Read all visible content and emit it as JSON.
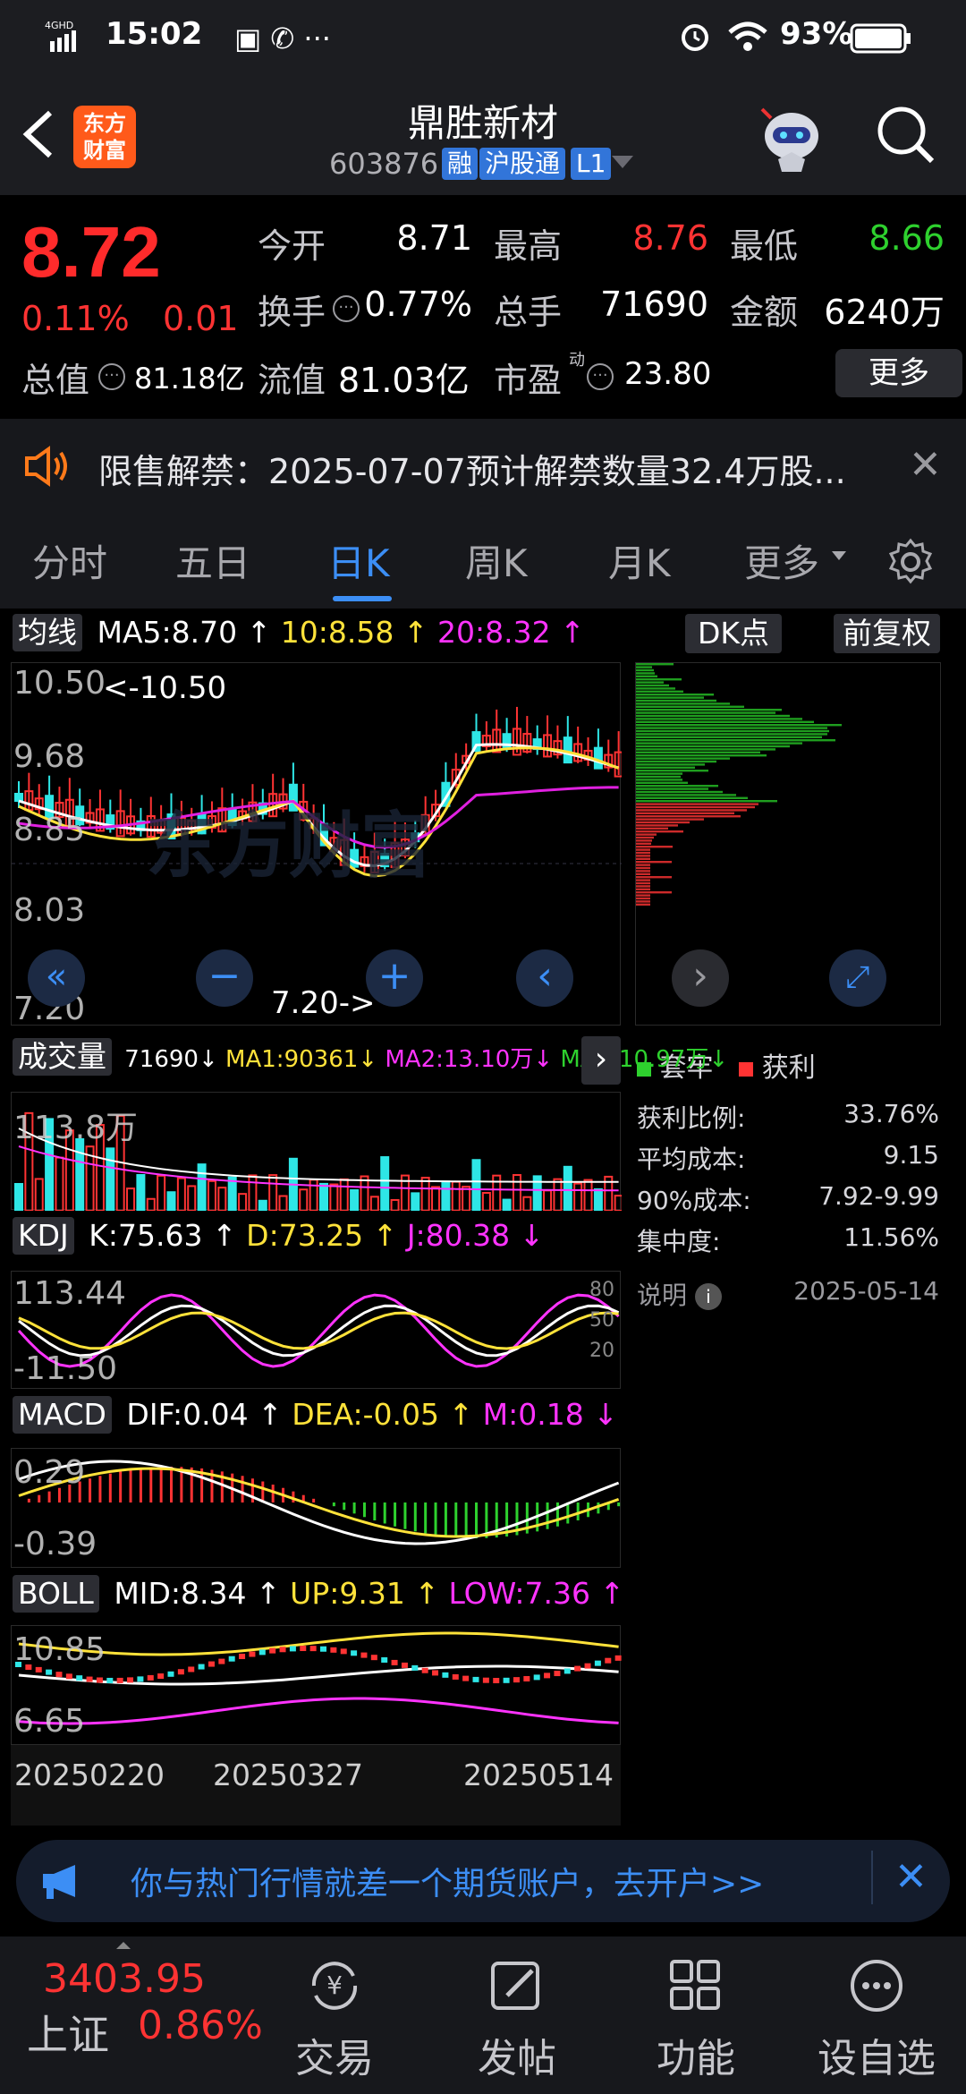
{
  "status": {
    "network": "4GHD",
    "time": "15:02",
    "icons_left": [
      "edit-doc-icon",
      "phone-icon",
      "more-dots"
    ],
    "battery": "93%"
  },
  "header": {
    "title": "鼎胜新材",
    "code": "603876",
    "tags": [
      "融",
      "沪股通",
      "L1"
    ],
    "logo_text": [
      "东方",
      "财富"
    ]
  },
  "quote": {
    "price": "8.72",
    "change_pct": "0.11%",
    "change": "0.01",
    "open_label": "今开",
    "open": "8.71",
    "high_label": "最高",
    "high": "8.76",
    "low_label": "最低",
    "low": "8.66",
    "turnover_label": "换手",
    "turnover": "0.77%",
    "volume_label": "总手",
    "volume": "71690",
    "amount_label": "金额",
    "amount": "6240万",
    "mcap_label": "总值",
    "mcap": "81.18亿",
    "float_label": "流值",
    "float": "81.03亿",
    "pe_label": "市盈",
    "pe_sup": "动",
    "pe": "23.80",
    "more": "更多"
  },
  "notice": {
    "text": "限售解禁：2025-07-07预计解禁数量32.4万股..."
  },
  "tabs": [
    "分时",
    "五日",
    "日K",
    "周K",
    "月K",
    "更多"
  ],
  "active_tab": "日K",
  "ma": {
    "selector": "均线",
    "ma5": "MA5:8.70",
    "ma10": "10:8.58",
    "ma20": "20:8.32",
    "dk": "DK点",
    "fq": "前复权"
  },
  "kline": {
    "y_labels": [
      "10.50",
      "9.68",
      "8.85",
      "8.03",
      "7.20"
    ],
    "max_label": "<-10.50",
    "min_label": "7.20->",
    "watermark": "东方财富"
  },
  "volume": {
    "selector": "成交量",
    "vol": "71690",
    "ma1": "MA1:90361",
    "ma2": "MA2:13.10万",
    "ma3": "MA3:10.97万",
    "y_label": "113.8万"
  },
  "kdj": {
    "selector": "KDJ",
    "k": "K:75.63",
    "d": "D:73.25",
    "j": "J:80.38",
    "y_top": "113.44",
    "y_bot": "-11.50",
    "levels": [
      "80",
      "50",
      "20"
    ]
  },
  "macd": {
    "selector": "MACD",
    "dif": "DIF:0.04",
    "dea": "DEA:-0.05",
    "m": "M:0.18",
    "y_top": "0.29",
    "y_bot": "-0.39"
  },
  "boll": {
    "selector": "BOLL",
    "mid": "MID:8.34",
    "up": "UP:9.31",
    "low": "LOW:7.36",
    "y_top": "10.85",
    "y_bot": "6.65"
  },
  "dates": [
    "20250220",
    "20250327",
    "20250514"
  ],
  "chips": {
    "legend_trap": "套牢",
    "legend_profit": "获利",
    "rows": [
      {
        "label": "获利比例:",
        "value": "33.76%"
      },
      {
        "label": "平均成本:",
        "value": "9.15"
      },
      {
        "label": "90%成本:",
        "value": "7.92-9.99"
      },
      {
        "label": "集中度:",
        "value": "11.56%"
      }
    ],
    "note_label": "说明",
    "date": "2025-05-14"
  },
  "ad": {
    "text": "你与热门行情就差一个期货账户，去开户>>"
  },
  "bottom": {
    "index_value": "3403.95",
    "index_name": "上证",
    "index_change": "0.86%",
    "items": [
      "交易",
      "发帖",
      "功能",
      "设自选"
    ]
  },
  "colors": {
    "up": "#ff3333",
    "down": "#2ed12e",
    "accent": "#3c8ef5",
    "ma5": "#ffffff",
    "ma10": "#ffe23a",
    "ma20": "#ff33ff"
  }
}
